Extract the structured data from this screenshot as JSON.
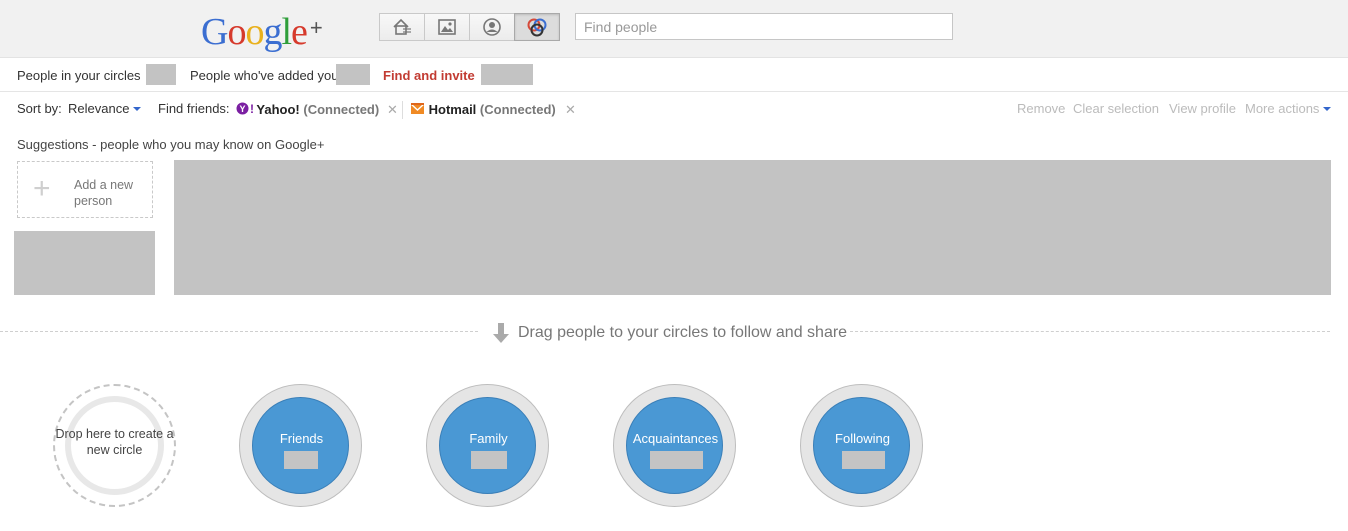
{
  "header": {
    "logo_letters": [
      "G",
      "o",
      "o",
      "g",
      "l",
      "e"
    ],
    "logo_colors": [
      "#3b6ed1",
      "#d63a2c",
      "#e9b11d",
      "#3b6ed1",
      "#2f9e3a",
      "#d63a2c"
    ],
    "logo_plus": "+",
    "nav_icons": [
      "home-stream-icon",
      "photos-icon",
      "profile-icon",
      "circles-icon"
    ],
    "active_nav": "circles-icon",
    "search_placeholder": "Find people"
  },
  "tabs": {
    "people_in_circles": "People in your circles",
    "people_added_you": "People who've added you",
    "find_and_invite": "Find and invite",
    "active": "find_and_invite",
    "active_color": "#c23b32"
  },
  "toolbar": {
    "sort_label": "Sort by:",
    "sort_value": "Relevance",
    "find_friends_label": "Find friends:",
    "providers": [
      {
        "name": "Yahoo!",
        "status": "(Connected)"
      },
      {
        "name": "Hotmail",
        "status": "(Connected)"
      }
    ],
    "remove": "Remove",
    "clear_selection": "Clear selection",
    "view_profile": "View profile",
    "more_actions": "More actions"
  },
  "suggestions": {
    "title": "Suggestions - people who you may know on Google+",
    "add_person": "Add a new person"
  },
  "drag_hint": "Drag people to your circles to follow and share",
  "circles": {
    "drop": "Drop here to create a new circle",
    "items": [
      {
        "name": "Friends"
      },
      {
        "name": "Family"
      },
      {
        "name": "Acquaintances"
      },
      {
        "name": "Following"
      }
    ],
    "circle_color": "#4a98d4"
  }
}
